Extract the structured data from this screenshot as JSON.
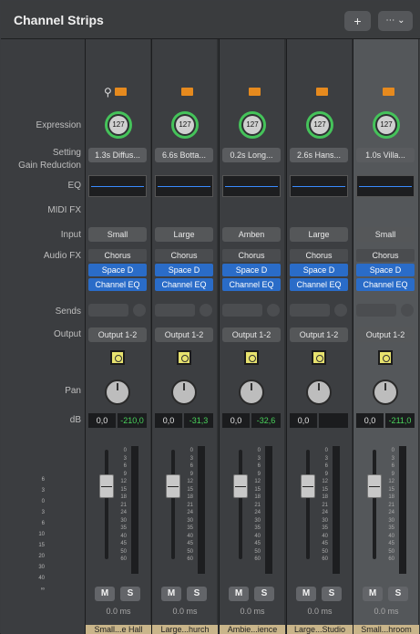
{
  "window": {
    "title": "Channel Strips",
    "add_button": "+",
    "more_button": "⋯ ⌄"
  },
  "labels": {
    "expression": "Expression",
    "setting": "Setting",
    "gain_reduction": "Gain Reduction",
    "eq": "EQ",
    "midi_fx": "MIDI FX",
    "input": "Input",
    "audio_fx": "Audio FX",
    "sends": "Sends",
    "output": "Output",
    "pan": "Pan",
    "db": "dB"
  },
  "left_scale": [
    "6",
    "3",
    "0",
    "3",
    "6",
    "10",
    "15",
    "20",
    "30",
    "40",
    "∞"
  ],
  "strips": [
    {
      "expression": "127",
      "setting": "1.3s Diffus...",
      "input": "Small",
      "plugins": [
        "Chorus",
        "Space D",
        "Channel EQ"
      ],
      "output": "Output 1-2",
      "db_value": "0,0",
      "db_peak": "-210,0",
      "latency": "0.0 ms",
      "m": "M",
      "s": "S",
      "name": "Small...e Hall",
      "fader_level": 0.67,
      "has_wrench": true,
      "selected": false
    },
    {
      "expression": "127",
      "setting": "6.6s Botta...",
      "input": "Large",
      "plugins": [
        "Chorus",
        "Space D",
        "Channel EQ"
      ],
      "output": "Output 1-2",
      "db_value": "0,0",
      "db_peak": "-31,3",
      "latency": "0.0 ms",
      "m": "M",
      "s": "S",
      "name": "Large...hurch",
      "fader_level": 0.67,
      "has_wrench": false,
      "selected": false
    },
    {
      "expression": "127",
      "setting": "0.2s Long...",
      "input": "Amben",
      "plugins": [
        "Chorus",
        "Space D",
        "Channel EQ"
      ],
      "output": "Output 1-2",
      "db_value": "0,0",
      "db_peak": "-32,6",
      "latency": "0.0 ms",
      "m": "M",
      "s": "S",
      "name": "Ambie...ience",
      "fader_level": 0.67,
      "has_wrench": false,
      "selected": false
    },
    {
      "expression": "127",
      "setting": "2.6s Hans...",
      "input": "Large",
      "plugins": [
        "Chorus",
        "Space D",
        "Channel EQ"
      ],
      "output": "Output 1-2",
      "db_value": "0,0",
      "db_peak": "",
      "latency": "0.0 ms",
      "m": "M",
      "s": "S",
      "name": "Large...Studio",
      "fader_level": 0.67,
      "has_wrench": false,
      "selected": false
    },
    {
      "expression": "127",
      "setting": "1.0s Villa...",
      "input": "Small",
      "plugins": [
        "Chorus",
        "Space D",
        "Channel EQ"
      ],
      "output": "Output 1-2",
      "db_value": "0,0",
      "db_peak": "-211,0",
      "latency": "0.0 ms",
      "m": "M",
      "s": "S",
      "name": "Small...hroom",
      "fader_level": 0.67,
      "has_wrench": false,
      "selected": true
    }
  ],
  "strip_scale": [
    "0",
    "3",
    "6",
    "9",
    "12",
    "15",
    "18",
    "21",
    "24",
    "30",
    "35",
    "40",
    "45",
    "50",
    "60"
  ],
  "colors": {
    "accent_green": "#45c35a",
    "plugin_blue": "#2a6cc8",
    "name_bar": "#c9b58a",
    "auto_yellow": "#e8e36e"
  }
}
